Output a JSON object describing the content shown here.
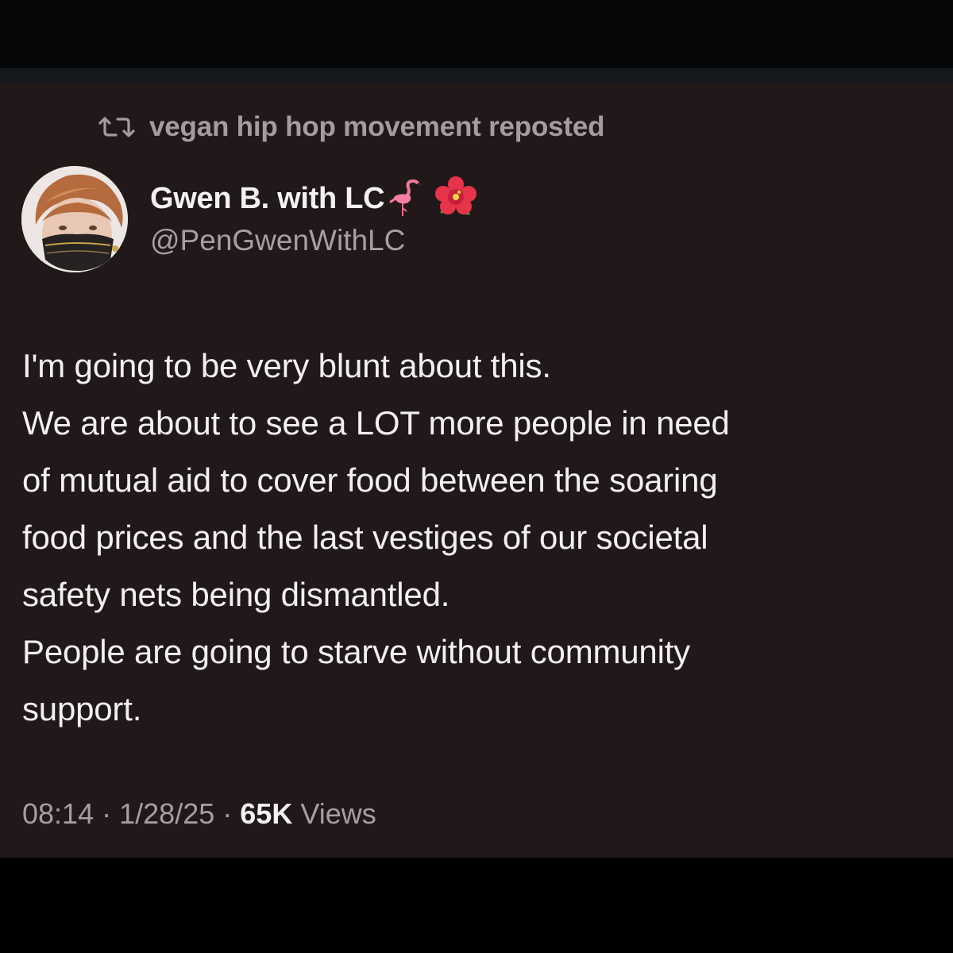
{
  "repost_bar": {
    "icon": "repost-icon",
    "text": "vegan hip hop movement reposted"
  },
  "author": {
    "display_name": "Gwen B. with LC",
    "name_emojis": [
      "flamingo-icon",
      "hibiscus-icon"
    ],
    "handle": "@PenGwenWithLC",
    "avatar": "avatar-photo"
  },
  "post": {
    "lines": [
      "I'm going to be very blunt about this.",
      "We are about to see a LOT more people in need",
      "of mutual aid to cover food between the soaring",
      "food prices and the last vestiges of our societal",
      "safety nets being dismantled.",
      "People are going to starve without community",
      "support."
    ]
  },
  "meta": {
    "time": "08:14",
    "separator": "·",
    "date": "1/28/25",
    "views_count": "65K",
    "views_label": "Views"
  },
  "colors": {
    "post_background": "#211819",
    "primary_text": "#f4f1f1",
    "secondary_text": "#a59fa2"
  }
}
